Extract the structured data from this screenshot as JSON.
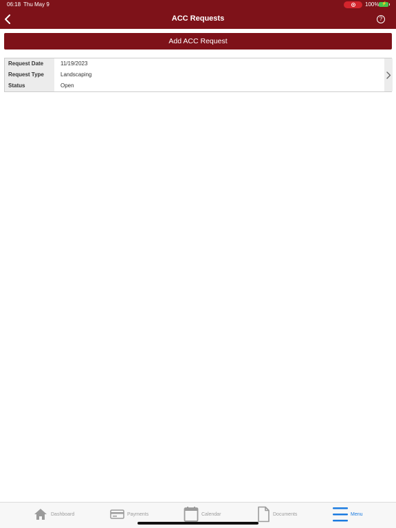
{
  "status_bar": {
    "time": "06:18",
    "date": "Thu May 9",
    "battery": "100%"
  },
  "header": {
    "title": "ACC Requests",
    "back_icon": "chevron-left-icon",
    "help_icon": "question-circle-icon",
    "help_glyph": "?"
  },
  "actions": {
    "add_label": "Add ACC Request"
  },
  "requests": [
    {
      "fields": [
        {
          "label": "Request Date",
          "value": "11/19/2023"
        },
        {
          "label": "Request Type",
          "value": "Landscaping"
        },
        {
          "label": "Status",
          "value": "Open"
        }
      ]
    }
  ],
  "tabs": [
    {
      "label": "Dashboard",
      "icon": "home-icon",
      "active": false
    },
    {
      "label": "Payments",
      "icon": "credit-card-icon",
      "active": false
    },
    {
      "label": "Calendar",
      "icon": "calendar-icon",
      "active": false
    },
    {
      "label": "Documents",
      "icon": "document-icon",
      "active": false
    },
    {
      "label": "Menu",
      "icon": "menu-icon",
      "active": true
    }
  ],
  "colors": {
    "brand": "#7e1219",
    "active_tab": "#1b7be0",
    "inactive_tab": "#9b9b9b"
  }
}
